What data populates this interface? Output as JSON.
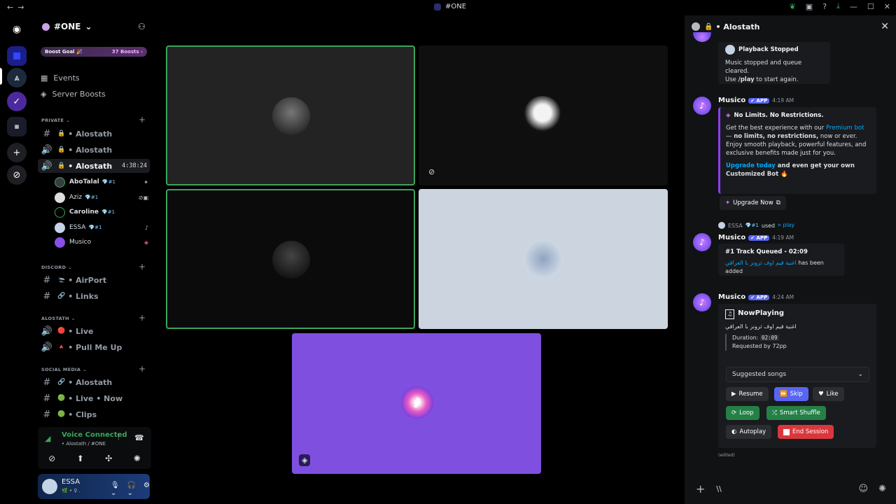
{
  "titlebar": {
    "back": "←",
    "forward": "→",
    "title": "#ONE"
  },
  "server": {
    "name": "#ONE",
    "boost_label": "Boost Goal 🎉",
    "boost_count": "37 Boosts"
  },
  "nav": {
    "events": "Events",
    "boosts": "Server Boosts"
  },
  "categories": {
    "private": "PRIVATE",
    "discord": "DISCORD",
    "alostath": "ALOSTATH",
    "social": "SOCIAL MEDIA"
  },
  "channels": {
    "private": [
      {
        "name": "• Alostath",
        "icon": "#"
      },
      {
        "name": "• Alostath",
        "icon": "🔊"
      },
      {
        "name": "• Alostath",
        "icon": "🔊",
        "timer": "4:38:24"
      }
    ],
    "discord": [
      {
        "name": "• AirPort",
        "icon": "#",
        "emoji": "🛬"
      },
      {
        "name": "• Links",
        "icon": "#",
        "emoji": "🔗"
      }
    ],
    "alostath": [
      {
        "name": "• Live",
        "icon": "🔊",
        "emoji": "🔴"
      },
      {
        "name": "• Pull Me Up",
        "icon": "🔊",
        "emoji": "🔺"
      }
    ],
    "social": [
      {
        "name": "• Alostath",
        "icon": "#",
        "emoji": "🔗"
      },
      {
        "name": "• Live • Now",
        "icon": "#",
        "emoji": "🟢"
      },
      {
        "name": "• Clips",
        "icon": "#",
        "emoji": "🟢"
      }
    ]
  },
  "voice_users": [
    {
      "name": "AboTalal",
      "badge": "💎#1"
    },
    {
      "name": "Aziz",
      "badge": "💎#1"
    },
    {
      "name": "Caroline",
      "badge": "💎#1"
    },
    {
      "name": "ESSA",
      "badge": "💎#1"
    },
    {
      "name": "Musico",
      "badge": ""
    }
  ],
  "voice_panel": {
    "status": "Voice Connected",
    "channel": "• Alostath / #ONE"
  },
  "user": {
    "name": "ESSA",
    "status": "🌿 • ♀ ."
  },
  "panel": {
    "title": "• Alostath"
  },
  "messages": {
    "m0": {
      "title": "Playback Stopped",
      "line1": "Music stopped and queue cleared.",
      "line2_a": "Use ",
      "line2_cmd": "/play",
      "line2_b": " to start again."
    },
    "m1": {
      "author": "Musico",
      "tag": "✔ APP",
      "time": "4:19 AM",
      "title": "No Limits. No Restrictions.",
      "p1_a": "Get the best experience with our ",
      "p1_link": "Premium bot",
      "p1_b": " — ",
      "p1_bold": "no limits, no restrictions,",
      "p1_c": " now or ever. Enjoy smooth playback, powerful features, and exclusive benefits made just for you.",
      "p2_link": "Upgrade today",
      "p2_rest": " and even get your own Customized Bot 🔥",
      "button": "Upgrade Now"
    },
    "m2": {
      "reply_user": "ESSA",
      "reply_badge": "💎#1",
      "reply_used": "used",
      "reply_cmd": "⌗ play",
      "author": "Musico",
      "tag": "✔ APP",
      "time": "4:19 AM",
      "title": "#1 Track Queued - 02:09",
      "song": "اغنية قيم اوف ثرونز با العراقي",
      "added": "has been added"
    },
    "m3": {
      "author": "Musico",
      "tag": "✔ APP",
      "time": "4:24 AM",
      "title": "NowPlaying",
      "song": "اغنية قيم اوف ثرونز با العراقي",
      "duration_label": "Duration:",
      "duration": "02:09",
      "requested": "Requested by 72pp",
      "select": "Suggested songs",
      "edited": "(edited)",
      "buttons": {
        "resume": "Resume",
        "skip": "Skip",
        "like": "Like",
        "loop": "Loop",
        "shuffle": "Smart Shuffle",
        "autoplay": "Autoplay",
        "end": "End Session"
      }
    }
  },
  "composer": {
    "text": "\\\\"
  },
  "colors": {
    "accent": "#5865f2",
    "green": "#248046",
    "red": "#da373c",
    "voice_green": "#3ba55c",
    "embed_bar": "#8c3ef2",
    "bot_tile": "#7f4fe0"
  }
}
